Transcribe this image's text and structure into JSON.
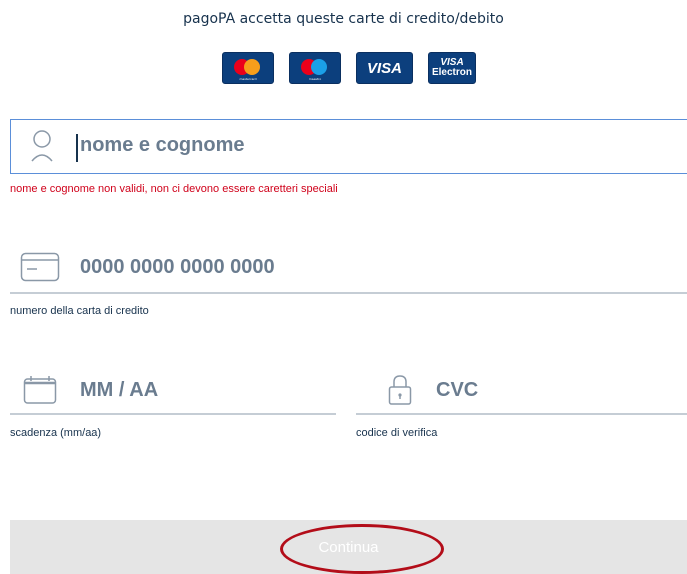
{
  "header": {
    "accepted_cards_text": "pagoPA accetta queste carte di credito/debito"
  },
  "cards": [
    {
      "name": "mastercard",
      "label": "mastercard"
    },
    {
      "name": "maestro",
      "label": "maestro"
    },
    {
      "name": "visa",
      "label": "VISA"
    },
    {
      "name": "visa-electron",
      "label_top": "VISA",
      "label_bottom": "Electron"
    }
  ],
  "form": {
    "name_field": {
      "placeholder": "nome e cognome",
      "error": "nome e cognome non validi, non ci devono essere caretteri speciali",
      "icon": "person-icon"
    },
    "card_number_field": {
      "placeholder": "0000 0000 0000 0000",
      "hint": "numero della carta di credito",
      "icon": "credit-card-icon"
    },
    "expiry_field": {
      "placeholder": "MM / AA",
      "hint": "scadenza (mm/aa)",
      "icon": "calendar-icon"
    },
    "cvc_field": {
      "placeholder": "CVC",
      "hint": "codice di verifica",
      "icon": "lock-icon"
    }
  },
  "actions": {
    "continue_label": "Continua"
  },
  "colors": {
    "text": "#17324d",
    "error": "#d0021b",
    "focus_border": "#5b8fd9",
    "annotation": "#b30d19",
    "button_disabled": "#e5e5e5"
  }
}
